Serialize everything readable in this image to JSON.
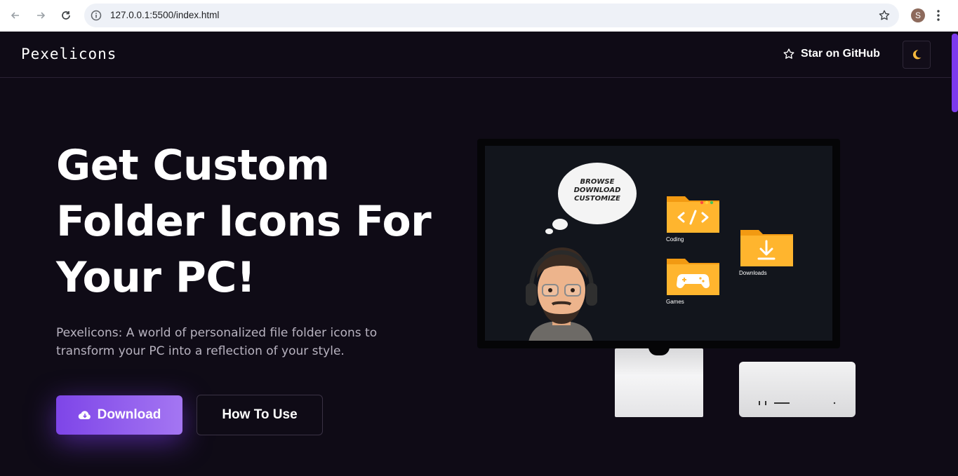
{
  "browser": {
    "url": "127.0.0.1:5500/index.html",
    "profile_initial": "S"
  },
  "nav": {
    "logo": "Pexelicons",
    "github_label": "Star on GitHub",
    "theme_icon": "moon-icon"
  },
  "hero": {
    "title": "Get Custom Folder Icons For Your PC!",
    "description": "Pexelicons: A world of personalized file folder icons to transform your PC into a reflection of your style.",
    "download_label": "Download",
    "howto_label": "How To Use"
  },
  "illustration": {
    "bubble_lines": [
      "BROWSE",
      "DOWNLOAD",
      "CUSTOMIZE"
    ],
    "folders": [
      {
        "label": "Coding",
        "icon": "code-icon"
      },
      {
        "label": "Downloads",
        "icon": "download-arrow-icon"
      },
      {
        "label": "Games",
        "icon": "gamepad-icon"
      }
    ]
  },
  "colors": {
    "background": "#0f0b16",
    "accent": "#7c3aed",
    "folder_orange": "#ffa21a"
  }
}
